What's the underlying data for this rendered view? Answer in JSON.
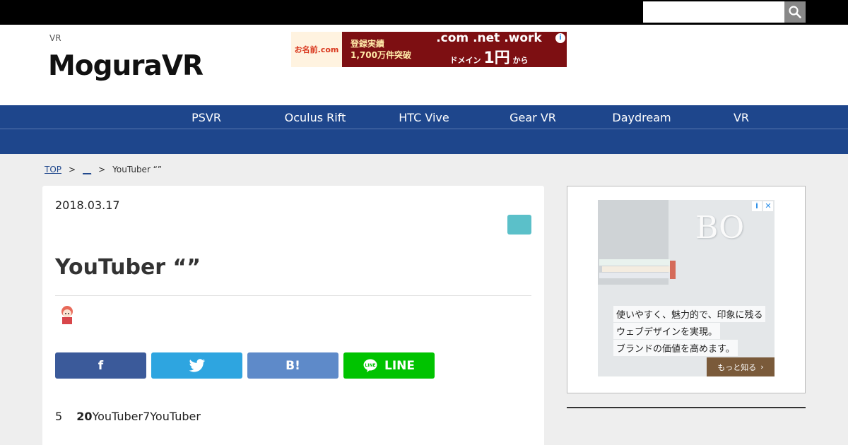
{
  "search": {
    "placeholder": "",
    "value": ""
  },
  "header": {
    "tagline": "VR",
    "logo": "MoguraVR",
    "ad": {
      "brand": "お名前.com",
      "line1": "登録実績",
      "line2": "1,700万件突破",
      "domains": ".com .net .work",
      "price": "1円",
      "price_suffix": "から",
      "label": "ドメイン"
    }
  },
  "nav": {
    "items": [
      {
        "label": "PSVR"
      },
      {
        "label": "Oculus Rift"
      },
      {
        "label": "HTC Vive"
      },
      {
        "label": "Gear VR"
      },
      {
        "label": "Daydream"
      },
      {
        "label": "VR"
      }
    ]
  },
  "breadcrumb": {
    "home": "TOP",
    "category": "__",
    "current": "YouTuber “”",
    "separator": ">"
  },
  "article": {
    "date": "2018.03.17",
    "title": "YouTuber “”",
    "body_prefix": "5",
    "body_bold": "20",
    "body_rest": "YouTuber7YouTuber"
  },
  "share": {
    "facebook": "f",
    "hatena": "B!",
    "line": "LINE"
  },
  "sidebar_ad": {
    "logo": "BO",
    "line1": "使いやすく、魅力的で、印象に残る",
    "line2": "ウェブデザインを実現。",
    "line3": "ブランドの価値を高めます。",
    "cta": "もっと知る",
    "info": "i",
    "close": "✕"
  },
  "colors": {
    "nav_bg": "#1e468c",
    "facebook": "#3b5a9a",
    "twitter": "#2ea5e0",
    "hatena": "#5e8ac9",
    "line": "#00c300",
    "category_tag": "#5bc0c9"
  }
}
